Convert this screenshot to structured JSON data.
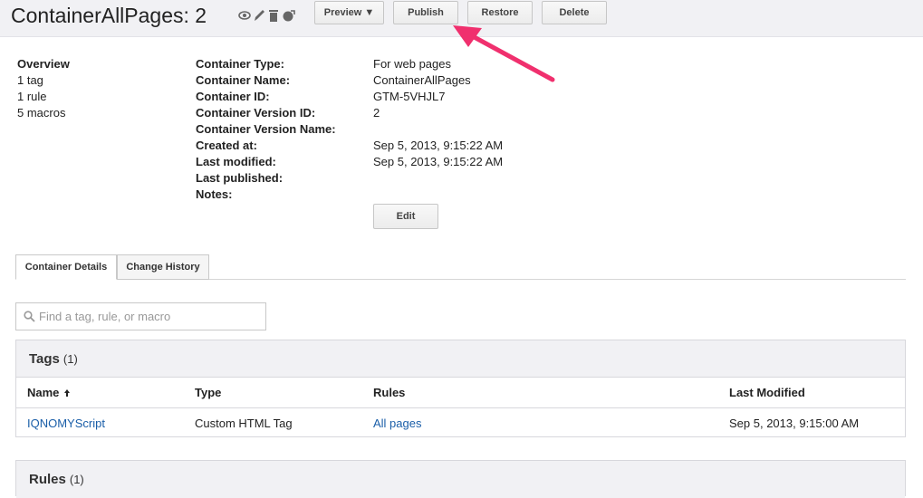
{
  "header": {
    "title": "ContainerAllPages: 2",
    "icons": [
      "eye-icon",
      "pencil-icon",
      "trash-icon",
      "globe-publish-icon"
    ],
    "buttons": {
      "preview": "Preview ▼",
      "publish": "Publish",
      "restore": "Restore",
      "delete": "Delete"
    }
  },
  "overview": {
    "heading": "Overview",
    "tags": "1 tag",
    "rules": "1 rule",
    "macros": "5 macros"
  },
  "properties": [
    {
      "label": "Container Type:",
      "value": "For web pages"
    },
    {
      "label": "Container Name:",
      "value": "ContainerAllPages"
    },
    {
      "label": "Container ID:",
      "value": "GTM-5VHJL7"
    },
    {
      "label": "Container Version ID:",
      "value": "2"
    },
    {
      "label": "Container Version Name:",
      "value": ""
    },
    {
      "label": "Created at:",
      "value": "Sep 5, 2013, 9:15:22 AM"
    },
    {
      "label": "Last modified:",
      "value": "Sep 5, 2013, 9:15:22 AM"
    },
    {
      "label": "Last published:",
      "value": ""
    },
    {
      "label": "Notes:",
      "value": ""
    }
  ],
  "edit_button": "Edit",
  "tabs": {
    "details": "Container Details",
    "history": "Change History"
  },
  "search": {
    "placeholder": "Find a tag, rule, or macro"
  },
  "tags_panel": {
    "heading": "Tags",
    "count": "(1)",
    "columns": {
      "name": "Name",
      "type": "Type",
      "rules": "Rules",
      "last_modified": "Last Modified"
    },
    "rows": [
      {
        "name": "IQNOMYScript",
        "type": "Custom HTML Tag",
        "rules": "All pages",
        "last_modified": "Sep 5, 2013, 9:15:00 AM"
      }
    ]
  },
  "rules_panel": {
    "heading": "Rules",
    "count": "(1)"
  },
  "colors": {
    "link": "#1a5ea8",
    "annotation_arrow": "#f0306e",
    "header_bg": "#f1f1f4"
  }
}
